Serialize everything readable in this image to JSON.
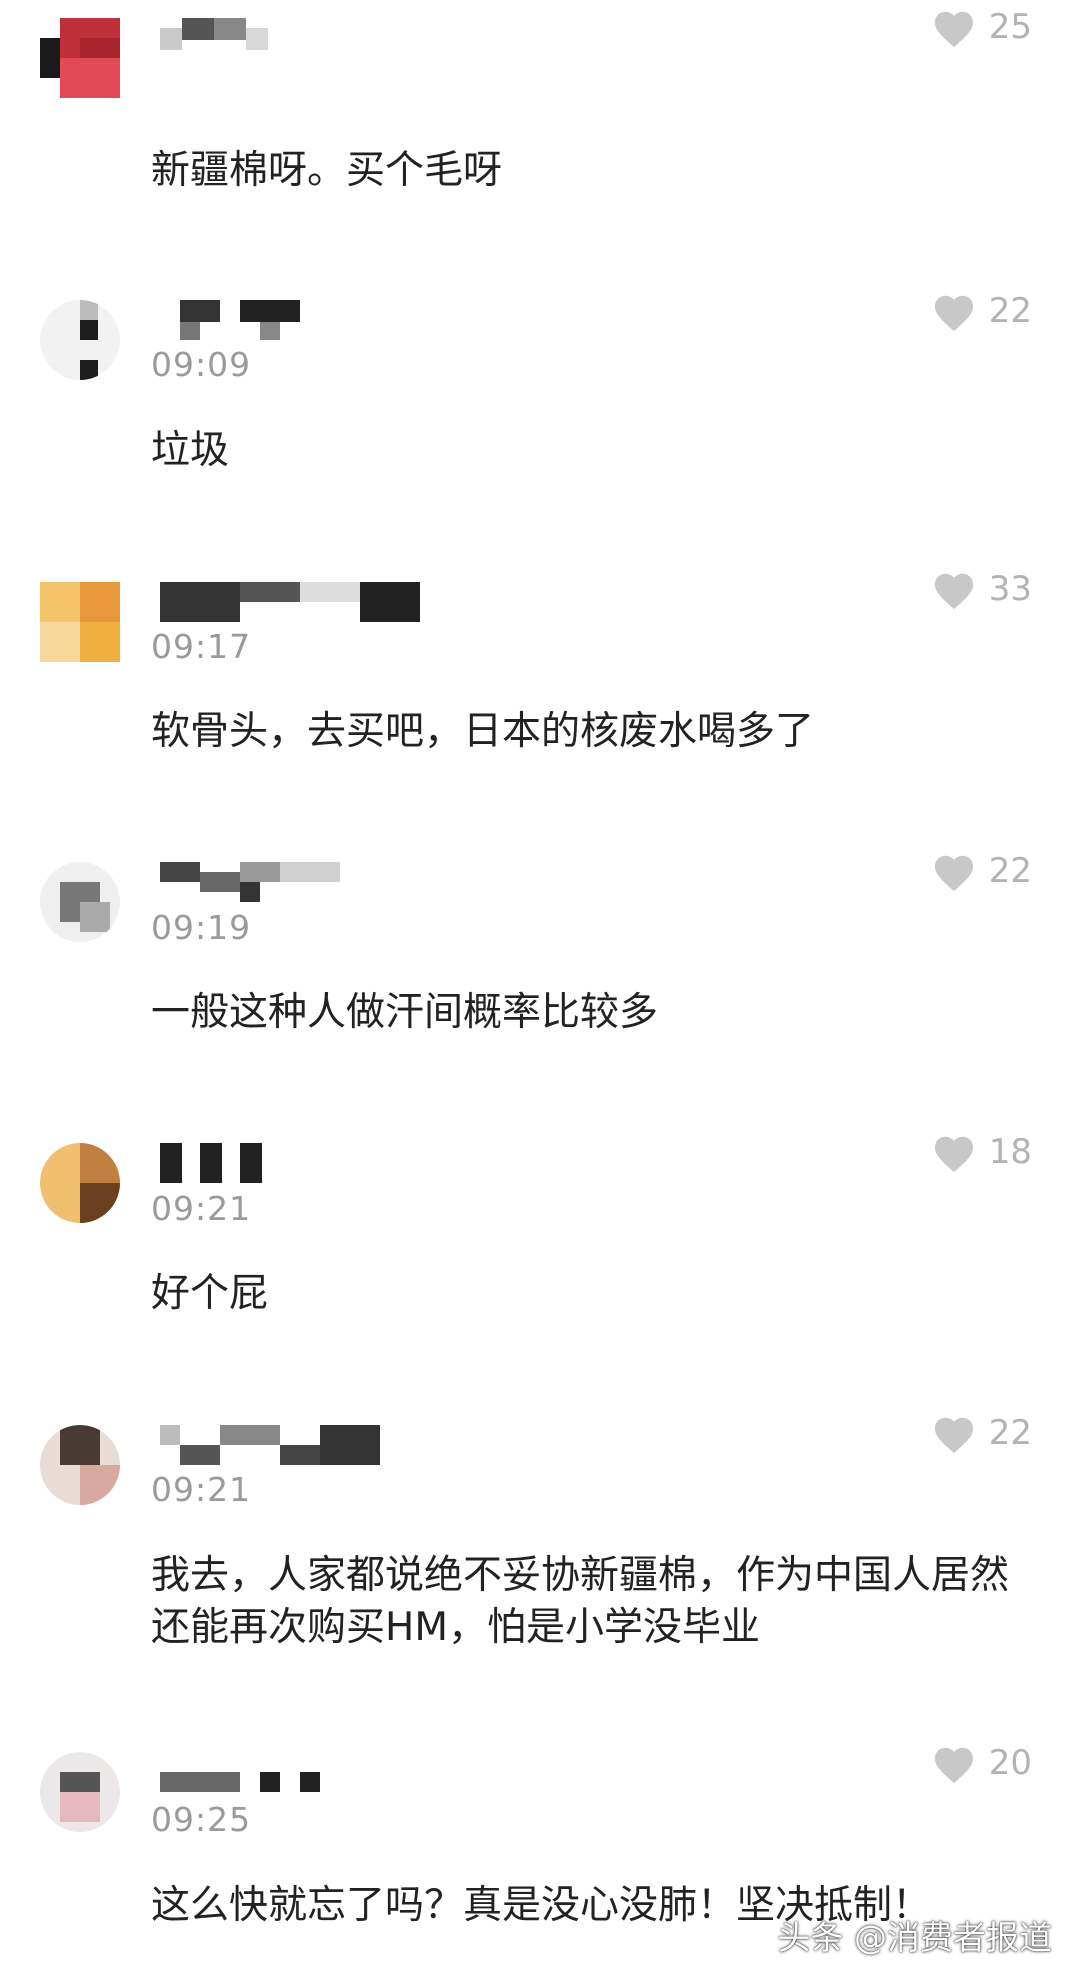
{
  "comments": [
    {
      "time": "",
      "likes": "25",
      "text": "新疆棉呀。买个毛呀"
    },
    {
      "time": "09:09",
      "likes": "22",
      "text": "垃圾"
    },
    {
      "time": "09:17",
      "likes": "33",
      "text": "软骨头，去买吧，日本的核废水喝多了"
    },
    {
      "time": "09:19",
      "likes": "22",
      "text": "一般这种人做汗间概率比较多"
    },
    {
      "time": "09:21",
      "likes": "18",
      "text": "好个屁"
    },
    {
      "time": "09:21",
      "likes": "22",
      "text": "我去，人家都说绝不妥协新疆棉，作为中国人居然还能再次购买HM，怕是小学没毕业"
    },
    {
      "time": "09:25",
      "likes": "20",
      "text": "这么快就忘了吗？真是没心没肺！坚决抵制！"
    }
  ],
  "watermark": "头条 @消费者报道",
  "colors": {
    "like_gray": "#b3b3b3",
    "time_gray": "#9a9a9a",
    "text": "#222222"
  },
  "icons": {
    "like": "heart-icon"
  }
}
